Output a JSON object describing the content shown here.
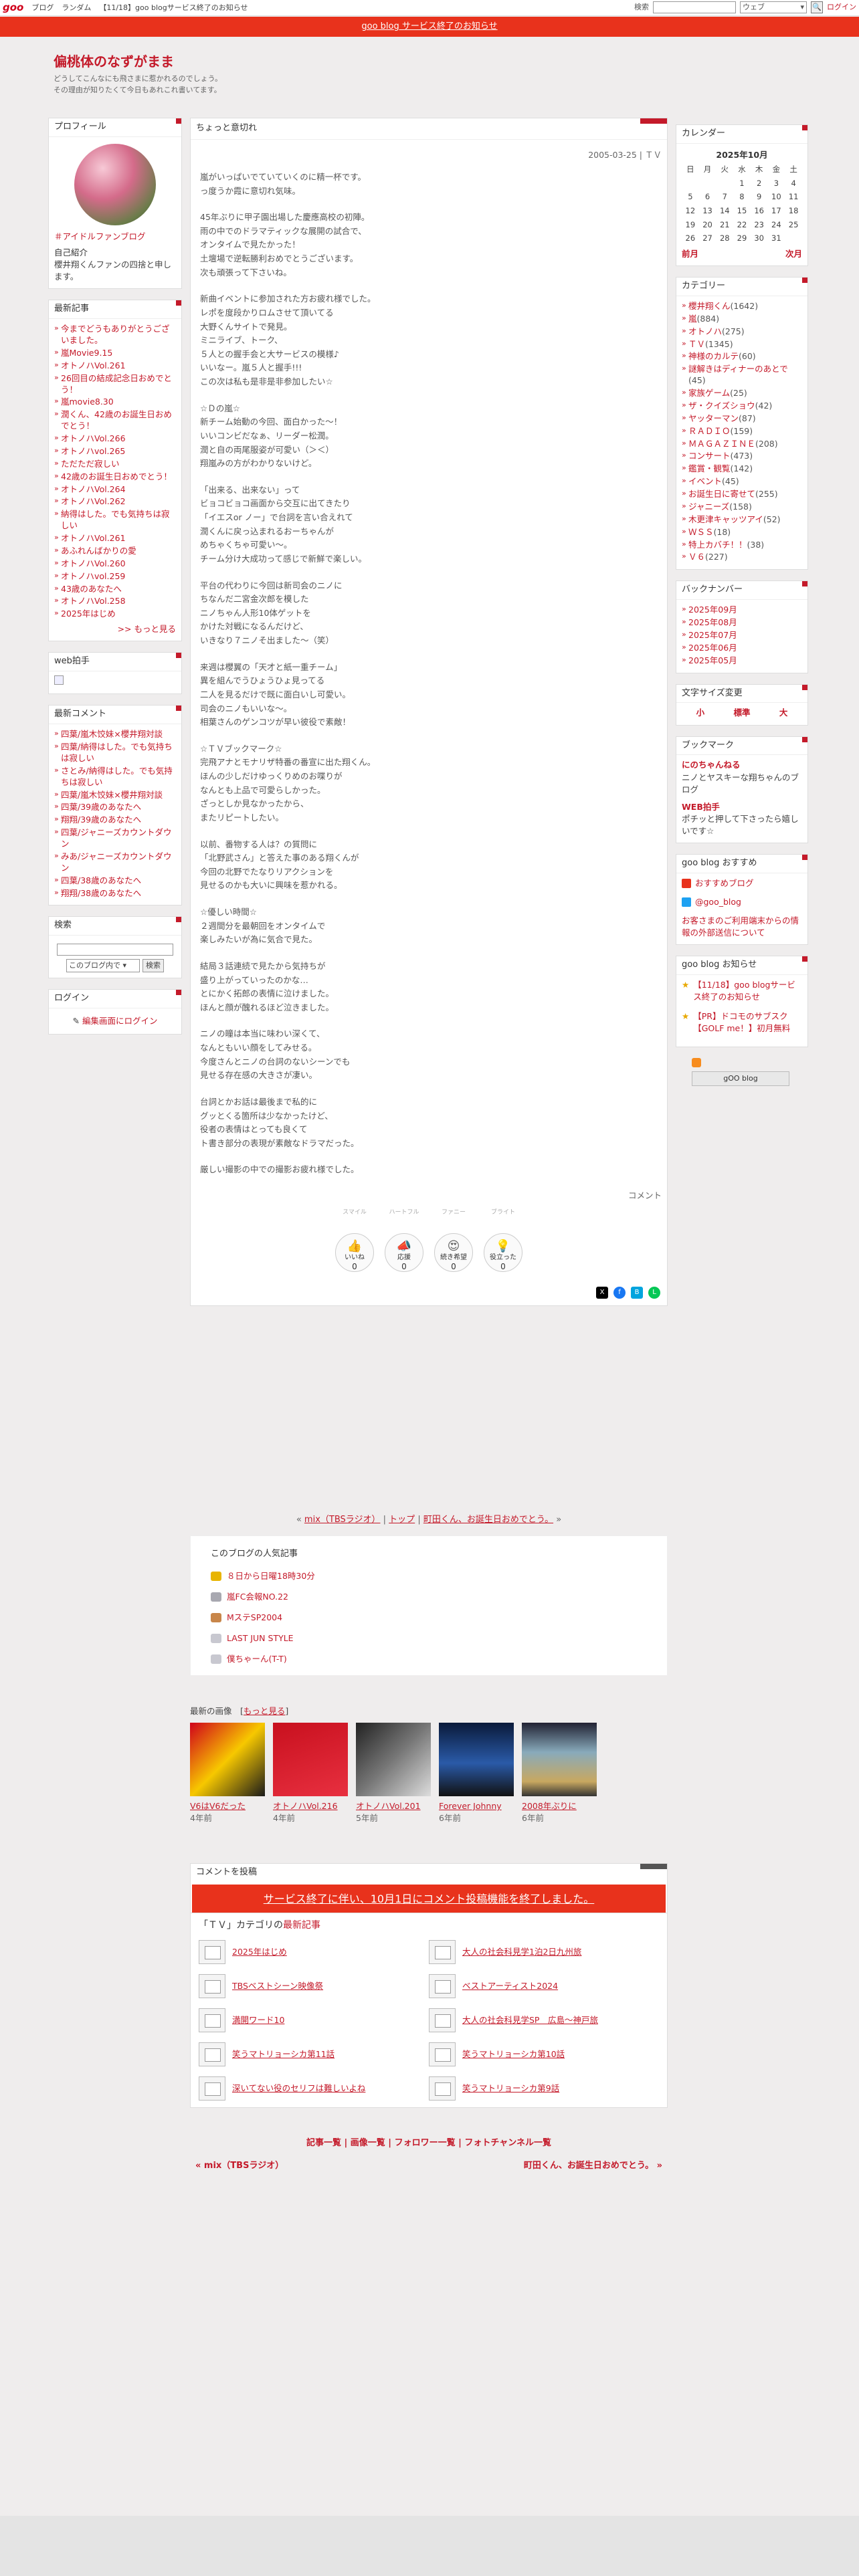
{
  "topbar": {
    "logo": "goo",
    "links": [
      "ブログ",
      "ランダム",
      "【11/18】goo blogサービス終了のお知らせ"
    ],
    "search_label": "検索",
    "select_value": "ウェブ",
    "login": "ログイン"
  },
  "notice": "goo blog サービス終了のお知らせ",
  "blog": {
    "title": "偏桃体のなずがまま",
    "desc1": "どうしてこんなにも飛さまに惹かれるのでしょう。",
    "desc2": "その理由が知りたくて今日もあれこれ書いてます。"
  },
  "profile": {
    "title": "プロフィール",
    "tag": "＃アイドルファンブログ",
    "intro_label": "自己紹介",
    "intro": "櫻井翔くんファンの四捨と申します。"
  },
  "recent": {
    "title": "最新記事",
    "items": [
      "今までどうもありがとうございました。",
      "嵐Movie9.15",
      "オトノハVol.261",
      "26回目の結成記念日おめでとう！",
      "嵐movie8.30",
      "潤くん、42歳のお誕生日おめでとう！",
      "オトノハVol.266",
      "オトノハvol.265",
      "ただただ寂しい",
      "42歳のお誕生日おめでとう！",
      "オトノハVol.264",
      "オトノハVol.262",
      "納得はした。でも気持ちは寂しい",
      "オトノハVol.261",
      "あふれんばかりの愛",
      "オトノハVol.260",
      "オトノハvol.259",
      "43歳のあなたへ",
      "オトノハVol.258",
      "2025年はじめ"
    ],
    "more": ">> もっと見る"
  },
  "web": {
    "title": "web拍手"
  },
  "comments": {
    "title": "最新コメント",
    "items": [
      "四葉/嵐木饺妹×櫻井翔対談",
      "四葉/納得はした。でも気持ちは寂しい",
      "さとみ/納得はした。でも気持ちは寂しい",
      "四葉/嵐木饺妹×櫻井翔対談",
      "四葉/39歳のあなたへ",
      "翔翔/39歳のあなたへ",
      "四葉/ジャニーズカウントダウン",
      "みあ/ジャニーズカウントダウン",
      "四葉/38歳のあなたへ",
      "翔翔/38歳のあなたへ"
    ]
  },
  "lsearch": {
    "title": "検索",
    "select": "このブログ内で",
    "btn": "検索"
  },
  "login": {
    "title": "ログイン",
    "btn": "編集画面にログイン"
  },
  "entry": {
    "title": "ちょっと意切れ",
    "meta": "2005-03-25 | ＴＶ",
    "paras": [
      "嵐がいっぱいでていていくのに精一杯です。\nっ度うか霞に意切れ気味。",
      "45年ぶりに甲子園出場した慶應高校の初陣。\n雨の中でのドラマティックな展開の試合で、\nオンタイムで見たかった！\n土壇場で逆転勝利おめでとうございます。\n次も頑張って下さいね。",
      "新曲イベントに参加された方お疲れ様でした。\nレポを度段かりロムさせて頂いてる\n大野くんサイトで発見。\nミニライブ、トーク、\n５人との握手会と大サービスの模様♪\nいいなー。嵐５人と握手!!!\nこの次は私も是非是非参加したい☆",
      "☆Ｄの嵐☆\n新チーム始動の今回、面白かった～！\nいいコンビだなぁ、リーダー松潤。\n潤と自の両尾服姿が可愛い（＞＜）\n翔嵐みの方がわかりないけど。",
      "「出来る、出来ない」って\nビョコビョコ画面から交互に出てきたり\n「イエスor ノー」で台詞を言い合えれて\n潤くんに戻っ込まれるおーちゃんが\nめちゃくちゃ可愛い～。\nチーム分け大成功って感じで新鮮で楽しい。",
      "平台の代わりに今回は新司会のニノに\nちなんだ二宮金次郎を模した\nニノちゃん人形10体ゲットを\nかけた対戦になるんだけど、\nいきなり７ニノそ出ました～（笑）",
      "来週は櫻翼の「天才と紙一重チーム」\n異を組んでうひょうひょ見ってる\n二人を見るだけで既に面白いし可愛い。\n司会のニノもいいな～。\n相葉さんのゲンコツが早い彼役で素敵！",
      "☆ＴＶブックマーク☆\n完飛アナとモナリザ特番の番宣に出た翔くん。\nほんの少しだけゆっくりめのお喋りが\nなんとも上品で可愛らしかった。\nざっとしか見なかったから、\nまたリピートしたい。",
      "以前、番物する人は？の質問に\n「北野武さん」と答えた事のある翔くんが\n今回の北野でたなりリアクションを\n見せるのかも大いに興味を惹かれる。",
      "☆優しい時間☆\n２週間分を最朝回をオンタイムで\n楽しみたいが為に気合で見た。",
      "結局３話連続で見たから気持ちが\n盛り上がっていったのかな…\nとにかく拓郎の表情に泣けました。\nほんと顔が醜れるほど泣きました。",
      "ニノの瞳は本当に味わい深くて、\nなんともいい顔をしてみせる。\n今度さんとニノの台詞のないシーンでも\n見せる存在感の大きさが凄い。",
      "台詞とかお話は最後まで私的に\nグッとくる箇所は少なかったけど、\n役者の表情はとっても良くて\nト書き部分の表現が素敵なドラマだった。",
      "厳しい撮影の中での撮影お疲れ様でした。"
    ],
    "comment_link": "コメント",
    "reactions": [
      {
        "top": "スマイル",
        "label": "いいね",
        "num": "0"
      },
      {
        "top": "ハートフル",
        "label": "応援",
        "num": "0"
      },
      {
        "top": "ファニー",
        "label": "続き希望",
        "num": "0"
      },
      {
        "top": "ブライト",
        "label": "役立った",
        "num": "0"
      }
    ]
  },
  "nav": {
    "prev": "mix（TBSラジオ）",
    "sep1": " | ",
    "top": "トップ",
    "sep2": " | ",
    "next": "町田くん、お誕生日おめでとう。"
  },
  "popular": {
    "title": "このブログの人気記事",
    "items": [
      "８日から日曜18時30分",
      "嵐FC会報NO.22",
      "MステSP2004",
      "LAST JUN STYLE",
      "僕ちゃーん(T-T)"
    ]
  },
  "images": {
    "title": "最新の画像",
    "more": "もっと見る",
    "items": [
      {
        "title": "V6はV6だった",
        "ago": "4年前"
      },
      {
        "title": "オトノハVol.216",
        "ago": "4年前"
      },
      {
        "title": "オトノハVol.201",
        "ago": "5年前"
      },
      {
        "title": "Forever Johnny",
        "ago": "6年前"
      },
      {
        "title": "2008年ぶりに",
        "ago": "6年前"
      }
    ]
  },
  "cmt": {
    "title": "コメントを投稿",
    "bar": "サービス終了に伴い、10月1日にコメント投稿機能を終了しました。"
  },
  "tvrec": {
    "title_pre": "「ＴＶ」カテゴリの",
    "title_r": "最新記事",
    "items": [
      "2025年はじめ",
      "大人の社会科見学1泊2日九州旅",
      "TBSベストシーン映像祭",
      "ベストアーティスト2024",
      "満開ワード10",
      "大人の社会科見学SP　広島～神戸旅",
      "笑うマトリョーシカ第11話",
      "笑うマトリョーシカ第10話",
      "深いてない役のセリフは難しいよね",
      "笑うマトリョーシカ第9話"
    ]
  },
  "foot": {
    "links": "記事一覧 | 画像一覧 | フォロワー一覧 | フォトチャンネル一覧",
    "prev": "« mix（TBSラジオ）",
    "next": "町田くん、お誕生日おめでとう。 »"
  },
  "calendar": {
    "title": "カレンダー",
    "month": "2025年10月",
    "days": [
      "日",
      "月",
      "火",
      "水",
      "木",
      "金",
      "土"
    ],
    "weeks": [
      [
        "",
        "",
        "",
        "1",
        "2",
        "3",
        "4"
      ],
      [
        "5",
        "6",
        "7",
        "8",
        "9",
        "10",
        "11"
      ],
      [
        "12",
        "13",
        "14",
        "15",
        "16",
        "17",
        "18"
      ],
      [
        "19",
        "20",
        "21",
        "22",
        "23",
        "24",
        "25"
      ],
      [
        "26",
        "27",
        "28",
        "29",
        "30",
        "31",
        ""
      ]
    ],
    "prev": "前月",
    "next": "次月"
  },
  "category": {
    "title": "カテゴリー",
    "items": [
      [
        "櫻井翔くん",
        "(1642)"
      ],
      [
        "嵐",
        "(884)"
      ],
      [
        "オトノハ",
        "(275)"
      ],
      [
        "ＴＶ",
        "(1345)"
      ],
      [
        "神様のカルテ",
        "(60)"
      ],
      [
        "謎解きはディナーのあとで",
        "(45)"
      ],
      [
        "家族ゲーム",
        "(25)"
      ],
      [
        "ザ・クイズショウ",
        "(42)"
      ],
      [
        "ヤッターマン",
        "(87)"
      ],
      [
        "ＲＡＤＩＯ",
        "(159)"
      ],
      [
        "ＭＡＧＡＺＩＮＥ",
        "(208)"
      ],
      [
        "コンサート",
        "(473)"
      ],
      [
        "鑑賞・観覧",
        "(142)"
      ],
      [
        "イベント",
        "(45)"
      ],
      [
        "お誕生日に寄せて",
        "(255)"
      ],
      [
        "ジャニーズ",
        "(158)"
      ],
      [
        "木更津キャッツアイ",
        "(52)"
      ],
      [
        "ＷＳＳ",
        "(18)"
      ],
      [
        "特上カバチ！！",
        "(38)"
      ],
      [
        "Ｖ６",
        "(227)"
      ]
    ]
  },
  "backnum": {
    "title": "バックナンバー",
    "items": [
      "2025年09月",
      "2025年08月",
      "2025年07月",
      "2025年06月",
      "2025年05月"
    ]
  },
  "fontsize": {
    "title": "文字サイズ変更",
    "opts": [
      "小",
      "標準",
      "大"
    ]
  },
  "bookmark": {
    "title": "ブックマーク",
    "b1": "にのちゃんねる",
    "b1d": "ニノとヤスキーな翔ちゃんのブログ",
    "b2": "WEB拍手",
    "b2d": "ポチッと押して下さったら嬉しいです☆"
  },
  "gooosusume": {
    "title": "goo blog おすすめ",
    "l1": "おすすめブログ",
    "l2": "@goo_blog",
    "l3": "お客さまのご利用端末からの情報の外部送信について"
  },
  "goonotice": {
    "title": "goo blog お知らせ",
    "n1": "【11/18】goo blogサービス終了のお知らせ",
    "n2": "【PR】ドコモのサブスク【GOLF me！】初月無料",
    "btn": "gOO blog"
  }
}
